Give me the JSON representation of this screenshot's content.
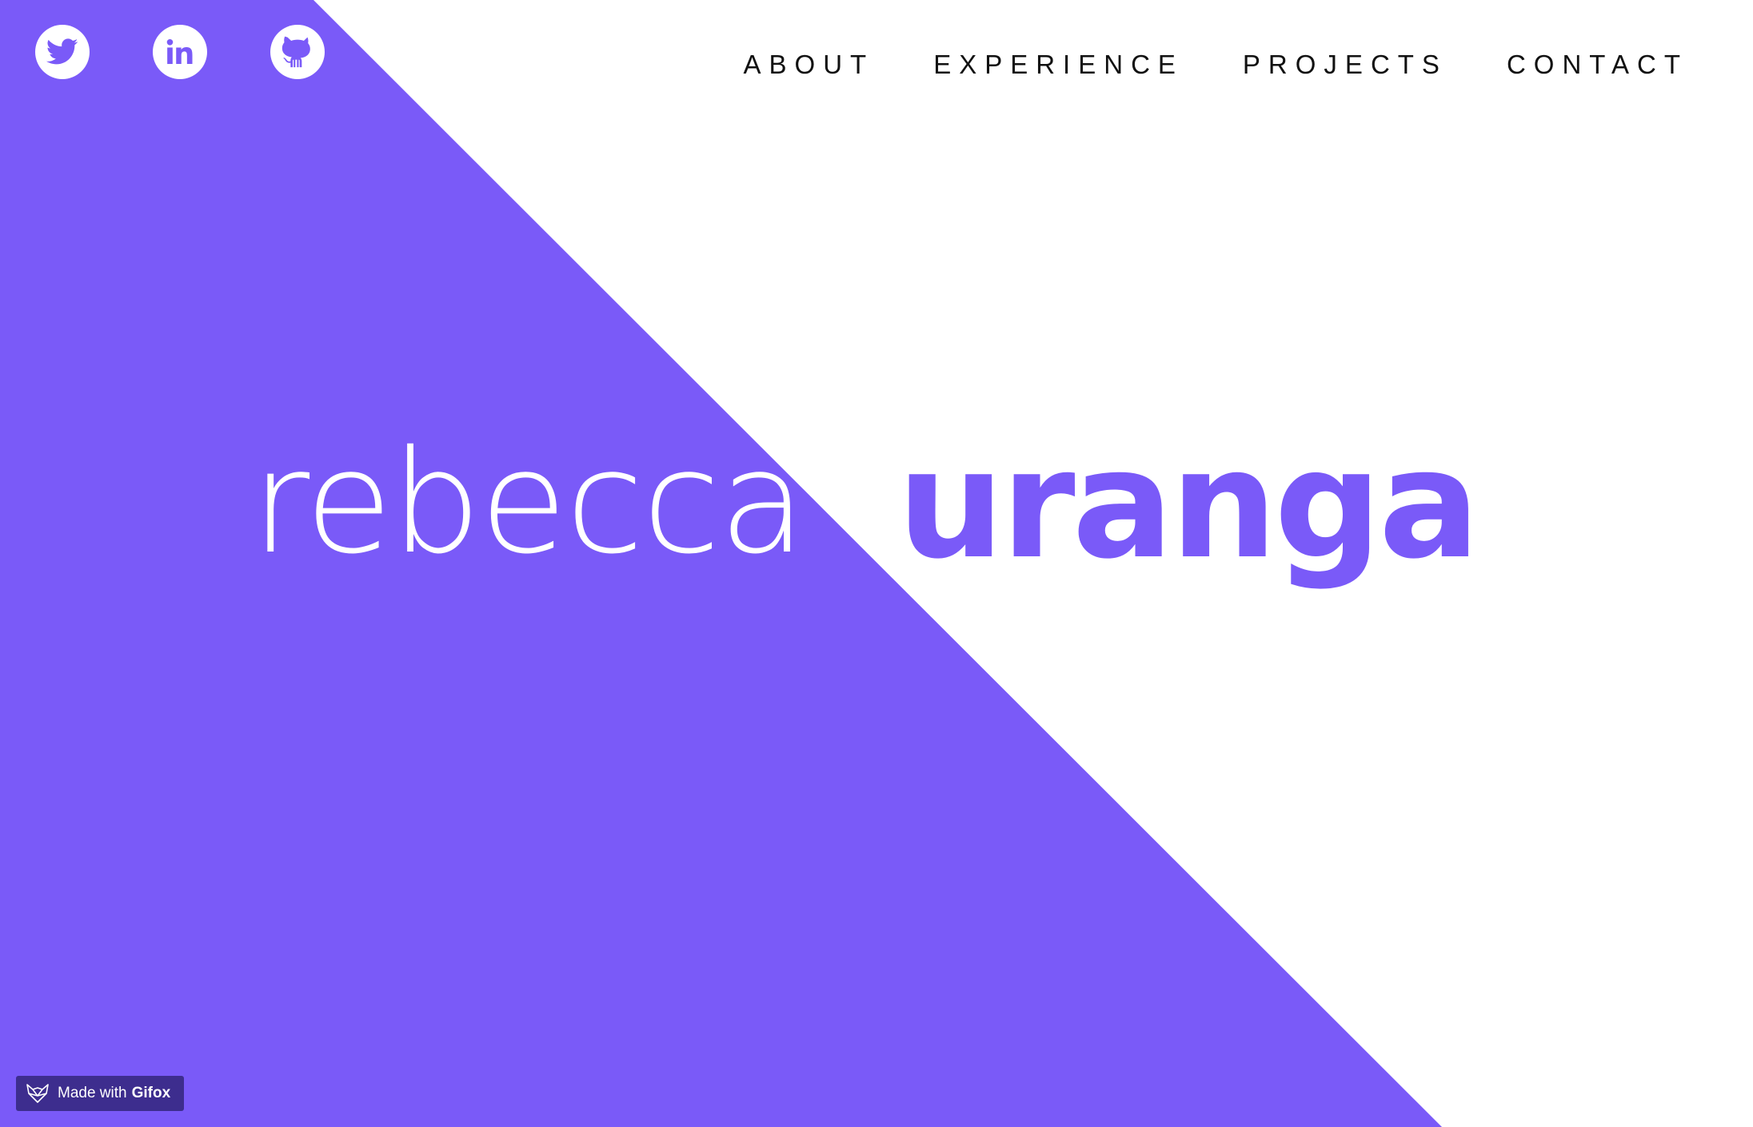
{
  "social": {
    "items": [
      {
        "icon": "twitter-icon"
      },
      {
        "icon": "linkedin-icon"
      },
      {
        "icon": "github-icon"
      }
    ]
  },
  "nav": {
    "about": "ABOUT",
    "experience": "EXPERIENCE",
    "projects": "PROJECTS",
    "contact": "CONTACT"
  },
  "hero": {
    "first_name": "rebecca",
    "last_name": "uranga"
  },
  "badge": {
    "prefix": "Made with",
    "brand": "Gifox",
    "icon": "fox-icon"
  },
  "colors": {
    "accent": "#7a5af8",
    "background": "#ffffff",
    "nav_text": "#111111",
    "badge_bg": "#3d2d8e"
  }
}
